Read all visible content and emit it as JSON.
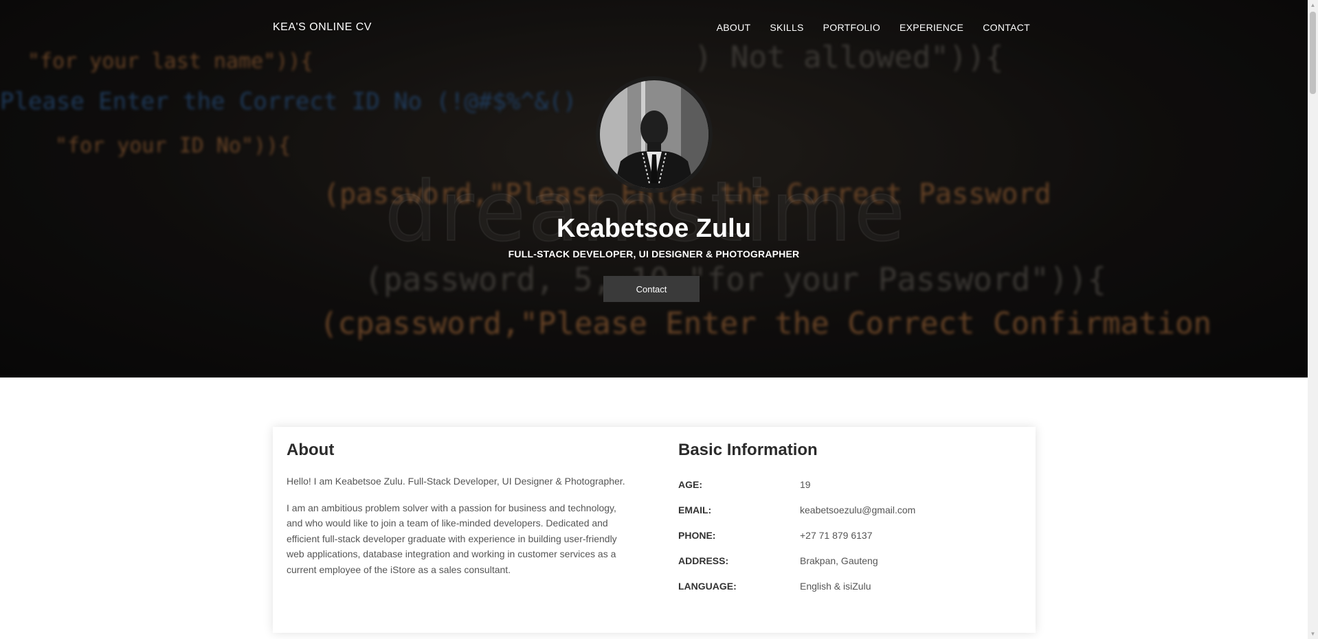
{
  "nav": {
    "brand": "KEA'S ONLINE CV",
    "links": [
      "ABOUT",
      "SKILLS",
      "PORTFOLIO",
      "EXPERIENCE",
      "CONTACT"
    ]
  },
  "hero": {
    "name": "Keabetsoe Zulu",
    "subtitle": "FULL-STACK DEVELOPER, UI DESIGNER & PHOTOGRAPHER",
    "button": "Contact",
    "background_code": [
      "\"for your last name\")){",
      ") Not allowed\")){",
      "Please Enter the Correct ID No (!@#$%^&()",
      "\"for your ID No\")){",
      "(password,\"Please Enter the Correct Password",
      "(password, 5, 10,\"for your Password\")){",
      "(cpassword,\"Please Enter the Correct Confirmation"
    ],
    "watermark": "dreamstime"
  },
  "about": {
    "title": "About",
    "paragraph1": "Hello! I am Keabetsoe Zulu. Full-Stack Developer, UI Designer & Photographer.",
    "paragraph2": "I am an ambitious problem solver with a passion for business and technology, and who would like to join a team of like-minded developers. Dedicated and efficient full-stack developer graduate with experience in building user-friendly web applications, database integration and working in customer services as a current employee of the iStore as a sales consultant."
  },
  "basic_info": {
    "title": "Basic Information",
    "rows": [
      {
        "label": "AGE:",
        "value": "19"
      },
      {
        "label": "EMAIL:",
        "value": "keabetsoezulu@gmail.com"
      },
      {
        "label": "PHONE:",
        "value": "+27 71 879 6137"
      },
      {
        "label": "ADDRESS:",
        "value": "Brakpan, Gauteng"
      },
      {
        "label": "LANGUAGE:",
        "value": "English & isiZulu"
      }
    ]
  },
  "colors": {
    "hero_bg": "#141211",
    "button_bg": "#3a3a3a",
    "text_dark": "#2b2b2b",
    "text_body": "#555555"
  }
}
